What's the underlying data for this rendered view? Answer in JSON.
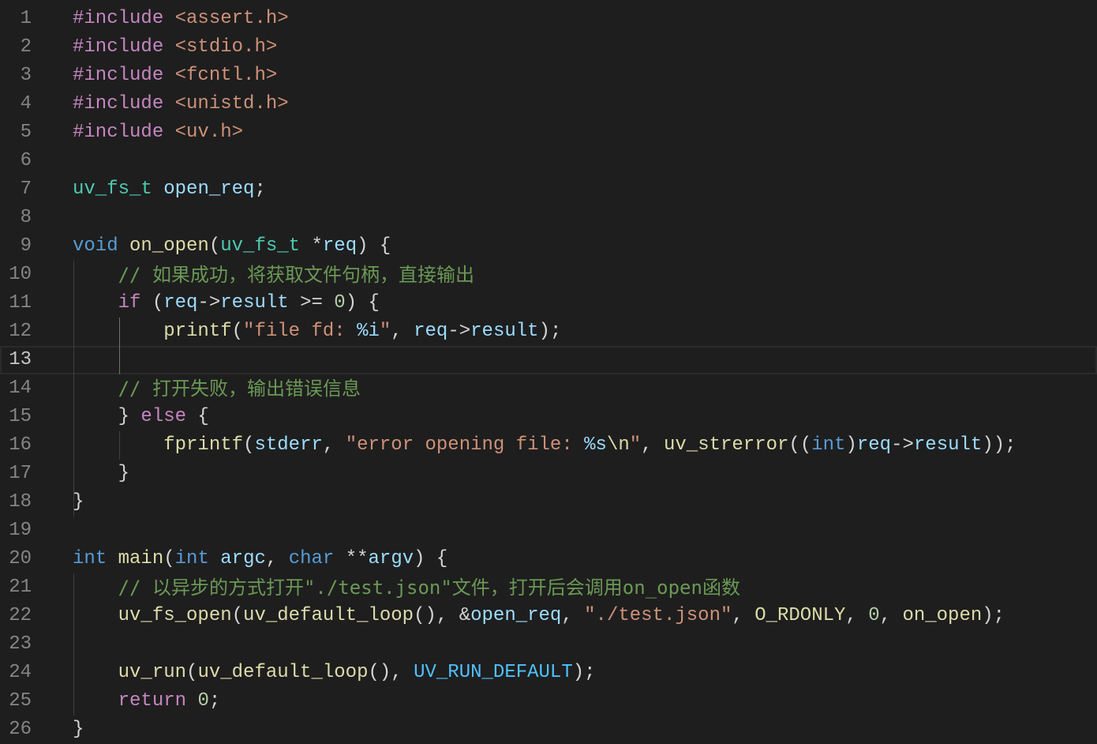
{
  "editor": {
    "active_line": 13,
    "colors": {
      "background": "#1e1e1e",
      "line_number": "#858585",
      "line_number_active": "#c6c6c6",
      "preprocessor": "#c586c0",
      "string": "#ce9178",
      "type": "#4ec9b0",
      "variable": "#9cdcfe",
      "function": "#dcdcaa",
      "keyword": "#569cd6",
      "control": "#c586c0",
      "number": "#b5cea8",
      "comment": "#6a9955",
      "constant": "#4fc1ff",
      "plain": "#d4d4d4"
    },
    "lines": [
      {
        "n": "1",
        "tokens": [
          [
            "pre",
            "#include "
          ],
          [
            "str",
            "<assert.h>"
          ]
        ]
      },
      {
        "n": "2",
        "tokens": [
          [
            "pre",
            "#include "
          ],
          [
            "str",
            "<stdio.h>"
          ]
        ]
      },
      {
        "n": "3",
        "tokens": [
          [
            "pre",
            "#include "
          ],
          [
            "str",
            "<fcntl.h>"
          ]
        ]
      },
      {
        "n": "4",
        "tokens": [
          [
            "pre",
            "#include "
          ],
          [
            "str",
            "<unistd.h>"
          ]
        ]
      },
      {
        "n": "5",
        "tokens": [
          [
            "pre",
            "#include "
          ],
          [
            "str",
            "<uv.h>"
          ]
        ]
      },
      {
        "n": "6",
        "tokens": []
      },
      {
        "n": "7",
        "tokens": [
          [
            "type",
            "uv_fs_t"
          ],
          [
            "pl",
            " "
          ],
          [
            "var",
            "open_req"
          ],
          [
            "pl",
            ";"
          ]
        ]
      },
      {
        "n": "8",
        "tokens": []
      },
      {
        "n": "9",
        "tokens": [
          [
            "kw",
            "void"
          ],
          [
            "pl",
            " "
          ],
          [
            "fn",
            "on_open"
          ],
          [
            "pl",
            "("
          ],
          [
            "type",
            "uv_fs_t"
          ],
          [
            "pl",
            " *"
          ],
          [
            "var",
            "req"
          ],
          [
            "pl",
            ") {"
          ]
        ]
      },
      {
        "n": "10",
        "tokens": [
          [
            "pl",
            "    "
          ],
          [
            "cm",
            "// 如果成功，将获取文件句柄，直接输出"
          ]
        ]
      },
      {
        "n": "11",
        "tokens": [
          [
            "pl",
            "    "
          ],
          [
            "ctl",
            "if"
          ],
          [
            "pl",
            " ("
          ],
          [
            "var",
            "req"
          ],
          [
            "pl",
            "->"
          ],
          [
            "var",
            "result"
          ],
          [
            "pl",
            " >= "
          ],
          [
            "num",
            "0"
          ],
          [
            "pl",
            ") {"
          ]
        ]
      },
      {
        "n": "12",
        "tokens": [
          [
            "pl",
            "        "
          ],
          [
            "fn",
            "printf"
          ],
          [
            "pl",
            "("
          ],
          [
            "str",
            "\"file fd: "
          ],
          [
            "var",
            "%i"
          ],
          [
            "str",
            "\""
          ],
          [
            "pl",
            ", "
          ],
          [
            "var",
            "req"
          ],
          [
            "pl",
            "->"
          ],
          [
            "var",
            "result"
          ],
          [
            "pl",
            ");"
          ]
        ]
      },
      {
        "n": "13",
        "tokens": []
      },
      {
        "n": "14",
        "tokens": [
          [
            "pl",
            "    "
          ],
          [
            "cm",
            "// 打开失败，输出错误信息"
          ]
        ]
      },
      {
        "n": "15",
        "tokens": [
          [
            "pl",
            "    } "
          ],
          [
            "ctl",
            "else"
          ],
          [
            "pl",
            " {"
          ]
        ]
      },
      {
        "n": "16",
        "tokens": [
          [
            "pl",
            "        "
          ],
          [
            "fn",
            "fprintf"
          ],
          [
            "pl",
            "("
          ],
          [
            "var",
            "stderr"
          ],
          [
            "pl",
            ", "
          ],
          [
            "str",
            "\"error opening file: "
          ],
          [
            "var",
            "%s"
          ],
          [
            "fn",
            "\\n"
          ],
          [
            "str",
            "\""
          ],
          [
            "pl",
            ", "
          ],
          [
            "fn",
            "uv_strerror"
          ],
          [
            "pl",
            "(("
          ],
          [
            "kw",
            "int"
          ],
          [
            "pl",
            ")"
          ],
          [
            "var",
            "req"
          ],
          [
            "pl",
            "->"
          ],
          [
            "var",
            "result"
          ],
          [
            "pl",
            "));"
          ]
        ]
      },
      {
        "n": "17",
        "tokens": [
          [
            "pl",
            "    }"
          ]
        ]
      },
      {
        "n": "18",
        "tokens": [
          [
            "pl",
            "}"
          ]
        ]
      },
      {
        "n": "19",
        "tokens": []
      },
      {
        "n": "20",
        "tokens": [
          [
            "kw",
            "int"
          ],
          [
            "pl",
            " "
          ],
          [
            "fn",
            "main"
          ],
          [
            "pl",
            "("
          ],
          [
            "kw",
            "int"
          ],
          [
            "pl",
            " "
          ],
          [
            "var",
            "argc"
          ],
          [
            "pl",
            ", "
          ],
          [
            "kw",
            "char"
          ],
          [
            "pl",
            " **"
          ],
          [
            "var",
            "argv"
          ],
          [
            "pl",
            ") {"
          ]
        ]
      },
      {
        "n": "21",
        "tokens": [
          [
            "pl",
            "    "
          ],
          [
            "cm",
            "// 以异步的方式打开\"./test.json\"文件，打开后会调用on_open函数"
          ]
        ]
      },
      {
        "n": "22",
        "tokens": [
          [
            "pl",
            "    "
          ],
          [
            "fn",
            "uv_fs_open"
          ],
          [
            "pl",
            "("
          ],
          [
            "fn",
            "uv_default_loop"
          ],
          [
            "pl",
            "(), &"
          ],
          [
            "var",
            "open_req"
          ],
          [
            "pl",
            ", "
          ],
          [
            "str",
            "\"./test.json\""
          ],
          [
            "pl",
            ", "
          ],
          [
            "fn",
            "O_RDONLY"
          ],
          [
            "pl",
            ", "
          ],
          [
            "num",
            "0"
          ],
          [
            "pl",
            ", "
          ],
          [
            "fn",
            "on_open"
          ],
          [
            "pl",
            ");"
          ]
        ]
      },
      {
        "n": "23",
        "tokens": []
      },
      {
        "n": "24",
        "tokens": [
          [
            "pl",
            "    "
          ],
          [
            "fn",
            "uv_run"
          ],
          [
            "pl",
            "("
          ],
          [
            "fn",
            "uv_default_loop"
          ],
          [
            "pl",
            "(), "
          ],
          [
            "const",
            "UV_RUN_DEFAULT"
          ],
          [
            "pl",
            ");"
          ]
        ]
      },
      {
        "n": "25",
        "tokens": [
          [
            "pl",
            "    "
          ],
          [
            "ctl",
            "return"
          ],
          [
            "pl",
            " "
          ],
          [
            "num",
            "0"
          ],
          [
            "pl",
            ";"
          ]
        ]
      },
      {
        "n": "26",
        "tokens": [
          [
            "pl",
            "}"
          ]
        ]
      }
    ]
  }
}
